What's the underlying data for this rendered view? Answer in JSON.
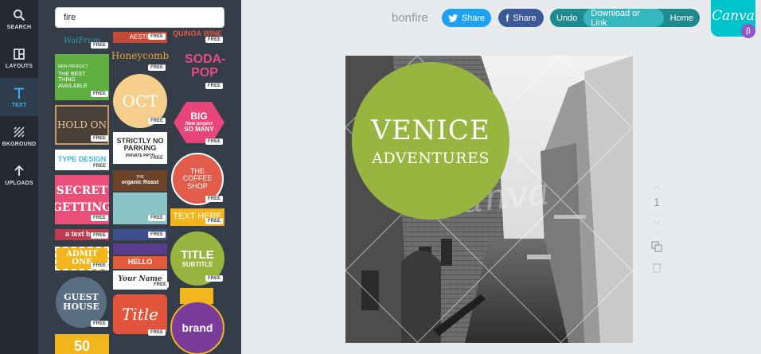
{
  "sidebar": {
    "items": [
      {
        "label": "SEARCH",
        "icon": "search-icon"
      },
      {
        "label": "LAYOUTS",
        "icon": "layouts-icon"
      },
      {
        "label": "TEXT",
        "icon": "text-icon"
      },
      {
        "label": "BKGROUND",
        "icon": "background-icon"
      },
      {
        "label": "UPLOADS",
        "icon": "upload-icon"
      }
    ]
  },
  "search": {
    "value": "fire"
  },
  "library": {
    "free_label": "FREE",
    "tiles": [
      "WalFrum",
      "AESTH",
      "QUINOA WINE",
      "NEW PRODUCT",
      "THE BEST THING AVAILABLE",
      "Honeycomb",
      "SODA-POP",
      "OCT",
      "HOLD ON",
      "BIG",
      "New project",
      "SO MANY",
      "STRICTLY NO PARKING",
      "PRIVATE PROP",
      "TYPE DESIGN",
      "THE COFFEE SHOP",
      "THE",
      "organic Roast",
      "SECRET",
      "GETTING",
      "TEXT HERE",
      "a text box",
      "TITLE",
      "SUBTITLE",
      "HELLO",
      "ADMIT ONE",
      "Your Name",
      "GUEST HOUSE",
      "Title",
      "brand",
      "50"
    ]
  },
  "topbar": {
    "doc_title": "bonfire",
    "twitter_share": "Share",
    "facebook_share": "Share",
    "undo": "Undo",
    "download": "Download or Link",
    "home": "Home",
    "logo": "Canva",
    "beta": "β"
  },
  "canvas": {
    "headline": "VENICE",
    "subhead": "ADVENTURES",
    "watermark": "canva"
  },
  "page_tools": {
    "page_number": "1"
  },
  "colors": {
    "rail": "#25282e",
    "panel": "#353d48",
    "accent": "#00c4cc",
    "circle": "#97b53f",
    "twitter": "#1da1f2",
    "facebook": "#3b5998"
  }
}
